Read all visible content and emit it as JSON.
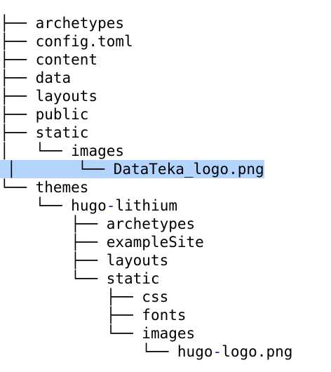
{
  "tree": {
    "entries": [
      {
        "prefix": "├── ",
        "name": "archetypes"
      },
      {
        "prefix": "├── ",
        "name": "config.toml"
      },
      {
        "prefix": "├── ",
        "name": "content"
      },
      {
        "prefix": "├── ",
        "name": "data"
      },
      {
        "prefix": "├── ",
        "name": "layouts"
      },
      {
        "prefix": "├── ",
        "name": "public"
      },
      {
        "prefix": "├── ",
        "name": "static"
      },
      {
        "prefix": "│   └── ",
        "name": "images"
      },
      {
        "prefix": "│       └── ",
        "name": "DataTeka_logo.png",
        "selected": true
      },
      {
        "prefix": "└── ",
        "name": "themes"
      },
      {
        "prefix": "    └── ",
        "name": "hugo-lithium"
      },
      {
        "prefix": "        ├── ",
        "name": "archetypes"
      },
      {
        "prefix": "        ├── ",
        "name": "exampleSite"
      },
      {
        "prefix": "        ├── ",
        "name": "layouts"
      },
      {
        "prefix": "        └── ",
        "name": "static"
      },
      {
        "prefix": "            ├── ",
        "name": "css"
      },
      {
        "prefix": "            ├── ",
        "name": "fonts"
      },
      {
        "prefix": "            └── ",
        "name": "images"
      },
      {
        "prefix": "                └── ",
        "name": "hugo-logo.png"
      }
    ]
  },
  "colors": {
    "selection_highlight": "#b3d4fc",
    "hyphen_blue": "#1c1cb8"
  }
}
